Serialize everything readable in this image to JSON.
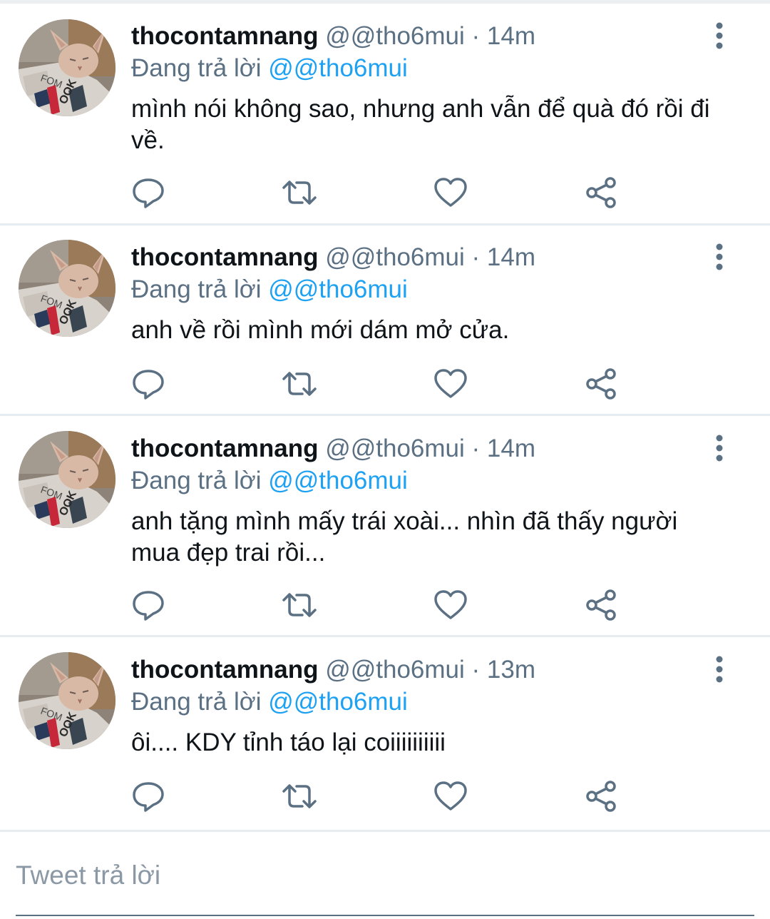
{
  "tweets": [
    {
      "display_name": "thocontamnang",
      "handle": "@@tho6mui",
      "separator": "·",
      "time": "14m",
      "reply_prefix": "Đang trả lời",
      "reply_handle": "@@tho6mui",
      "text": "mình nói không sao, nhưng anh vẫn để quà đó rồi đi về."
    },
    {
      "display_name": "thocontamnang",
      "handle": "@@tho6mui",
      "separator": "·",
      "time": "14m",
      "reply_prefix": "Đang trả lời",
      "reply_handle": "@@tho6mui",
      "text": "anh về rồi mình mới dám mở cửa."
    },
    {
      "display_name": "thocontamnang",
      "handle": "@@tho6mui",
      "separator": "·",
      "time": "14m",
      "reply_prefix": "Đang trả lời",
      "reply_handle": "@@tho6mui",
      "text": "anh tặng mình mấy trái xoài... nhìn đã thấy người mua đẹp trai rồi..."
    },
    {
      "display_name": "thocontamnang",
      "handle": "@@tho6mui",
      "separator": "·",
      "time": "13m",
      "reply_prefix": "Đang trả lời",
      "reply_handle": "@@tho6mui",
      "text": "ôi.... KDY tỉnh táo lại coiiiiiiiiii"
    }
  ],
  "icons": {
    "reply": "reply-icon",
    "retweet": "retweet-icon",
    "like": "heart-icon",
    "share": "share-icon",
    "more": "more-vertical-icon",
    "avatar": "cat-avatar"
  },
  "composer": {
    "placeholder": "Tweet trả lời"
  },
  "colors": {
    "link": "#1da1f2",
    "secondary_text": "#5b7083",
    "primary_text": "#0f1419",
    "divider": "#e6ecf0"
  }
}
